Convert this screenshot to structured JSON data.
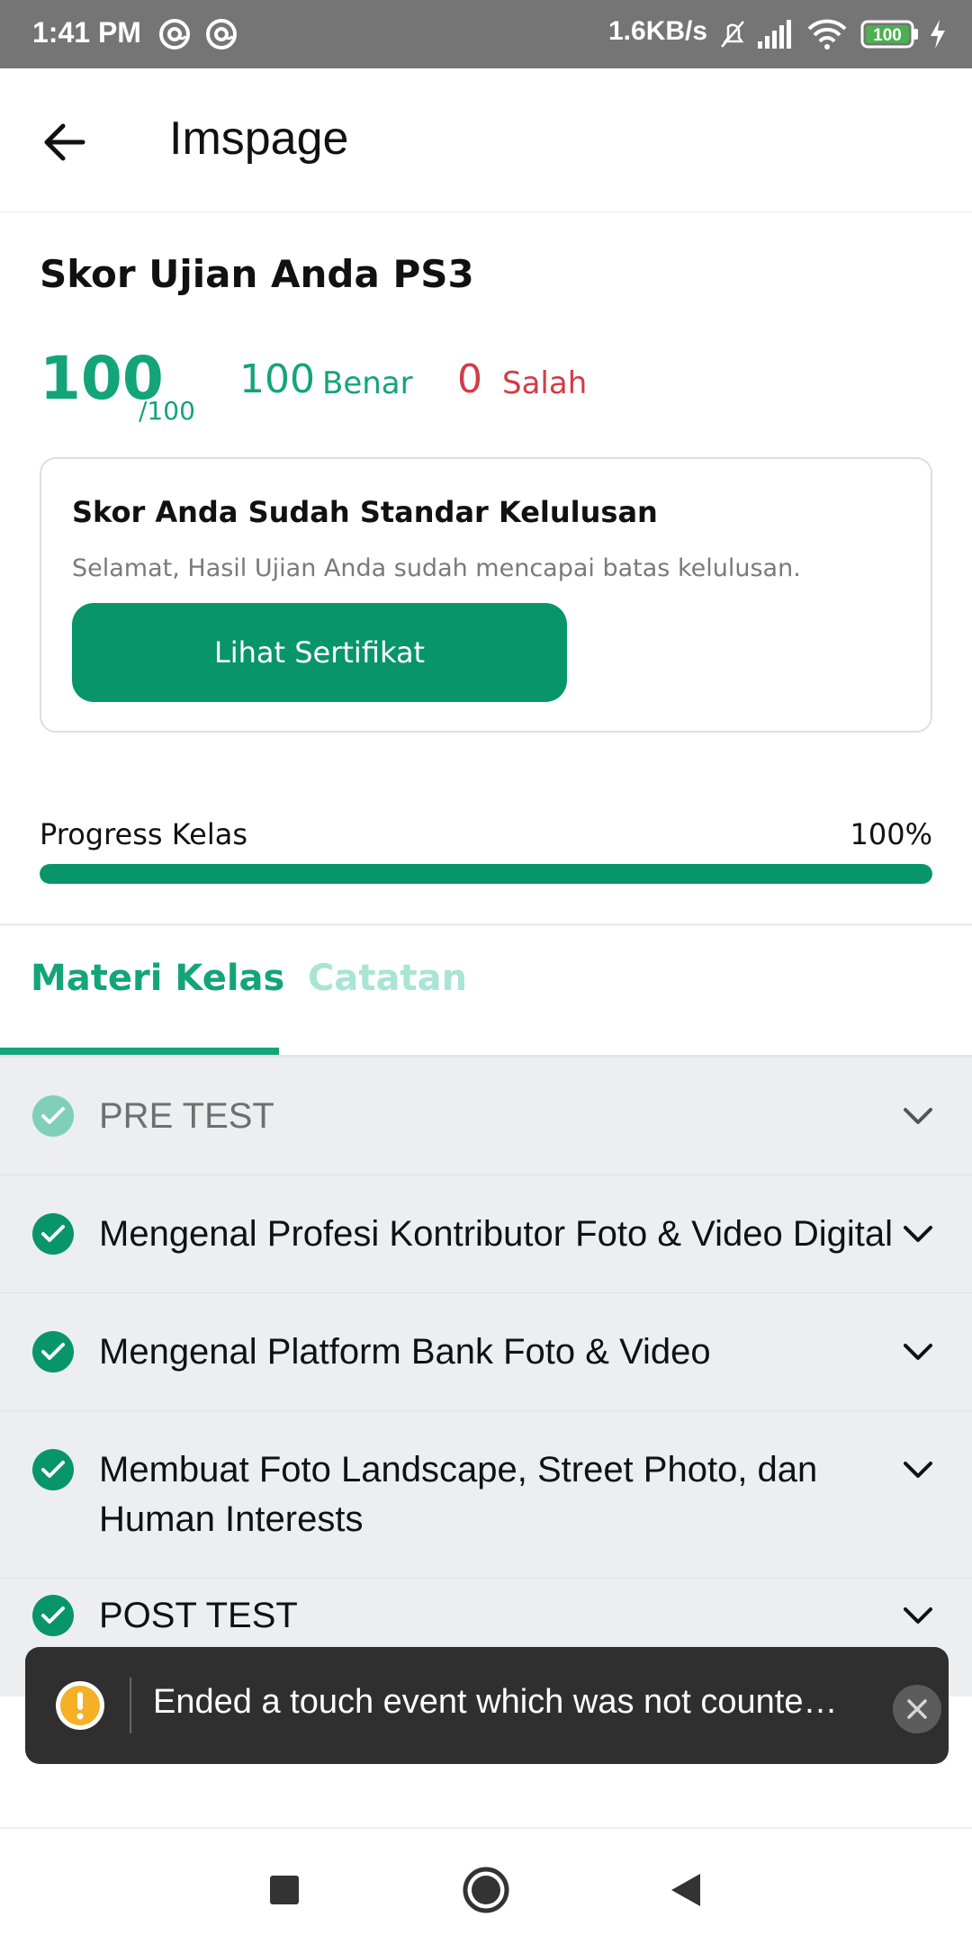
{
  "status_bar": {
    "time": "1:41 PM",
    "net_speed": "1.6KB/s",
    "battery": "100",
    "icons": [
      "at-icon",
      "at-icon",
      "bell-off-icon",
      "signal-icon",
      "wifi-icon",
      "battery-icon",
      "charging-icon"
    ]
  },
  "app_bar": {
    "title": "Imspage",
    "back_icon": "arrow-left-icon"
  },
  "score": {
    "title": "Skor Ujian Anda PS3",
    "value": "100",
    "max": "/100",
    "correct_count": "100",
    "correct_label": "Benar",
    "wrong_count": "0",
    "wrong_label": "Salah"
  },
  "pass_card": {
    "title": "Skor Anda Sudah Standar Kelulusan",
    "description": "Selamat, Hasil Ujian Anda sudah mencapai batas kelulusan.",
    "button_label": "Lihat Sertifikat"
  },
  "progress": {
    "label": "Progress Kelas",
    "value_text": "100%",
    "fraction": 1.0
  },
  "tabs": [
    {
      "label": "Materi Kelas",
      "active": true
    },
    {
      "label": "Catatan",
      "active": false
    }
  ],
  "materials": [
    {
      "label": "PRE TEST",
      "completed": true
    },
    {
      "label": "Mengenal Profesi Kontributor Foto & Video Digital",
      "completed": true
    },
    {
      "label": "Mengenal Platform Bank Foto & Video",
      "completed": true
    },
    {
      "label": "Membuat Foto Landscape, Street Photo, dan Human Interests",
      "completed": true
    },
    {
      "label": "POST TEST",
      "completed": true
    }
  ],
  "snackbar": {
    "message": "Ended a touch event which was not counted in `trackedTouchCount`.",
    "icon": "warning-icon",
    "close_icon": "close-icon"
  },
  "nav_bar": {
    "icons": [
      "recents-square-icon",
      "home-circle-icon",
      "back-triangle-icon"
    ]
  },
  "colors": {
    "accent": "#14a47a",
    "button": "#08956a",
    "error": "#d43b46",
    "statusbar": "#757575"
  }
}
